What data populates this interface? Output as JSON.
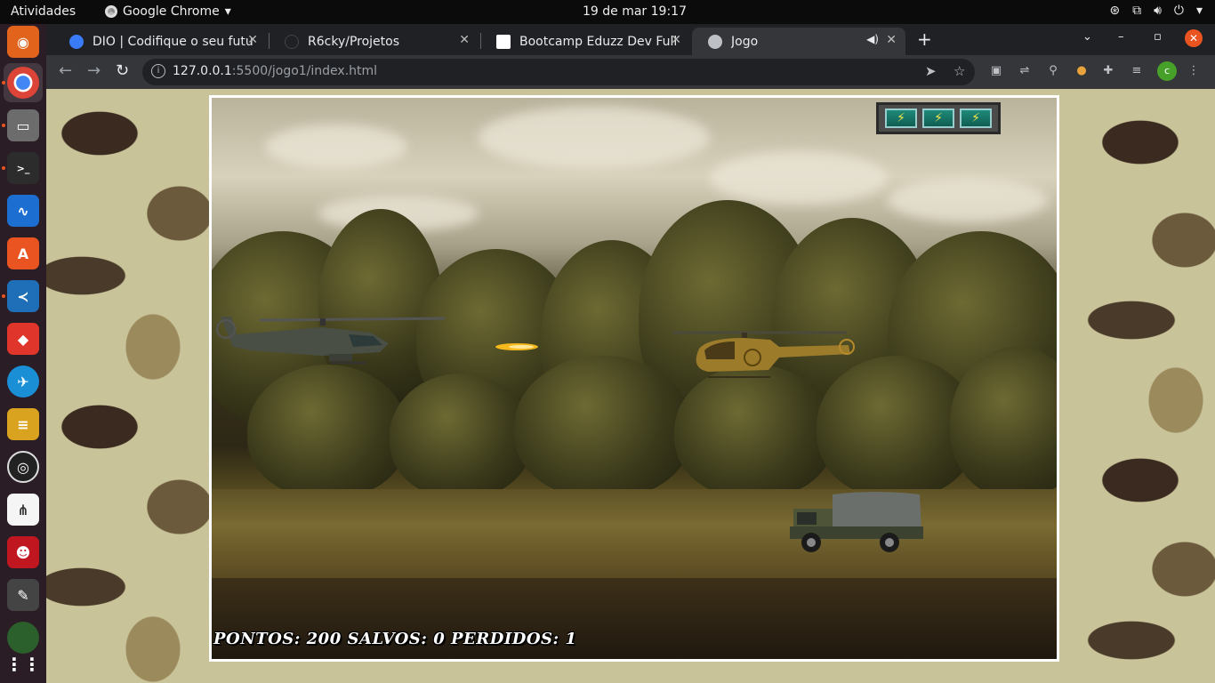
{
  "topbar": {
    "activities": "Atividades",
    "app_name": "Google Chrome",
    "clock": "19 de mar  19:17"
  },
  "tabs": [
    {
      "title": "DIO | Codifique o seu futu",
      "favicon_color": "#3a7bf7"
    },
    {
      "title": "R6cky/Projetos",
      "favicon_color": "#202124"
    },
    {
      "title": "Bootcamp Eduzz Dev Full",
      "favicon_color": "#ffffff"
    },
    {
      "title": "Jogo",
      "favicon_color": "#bdc1c6",
      "active": true,
      "audio": true
    }
  ],
  "toolbar": {
    "url_host": "127.0.0.1",
    "url_path": ":5500/jogo1/index.html",
    "profile_initial": "c"
  },
  "game": {
    "energy_cells": 3,
    "energy_icon": "lightning-icon",
    "score_label": "PONTOS: 200 SALVOS: 0 PERDIDOS: 1",
    "sprites": [
      "player-helicopter",
      "missile",
      "enemy-helicopter",
      "enemy-truck"
    ]
  },
  "colors": {
    "accent_ubuntu": "#e95420",
    "chrome_dark": "#202124",
    "chrome_toolbar": "#35363a",
    "camo_base": "#c9c39a"
  }
}
